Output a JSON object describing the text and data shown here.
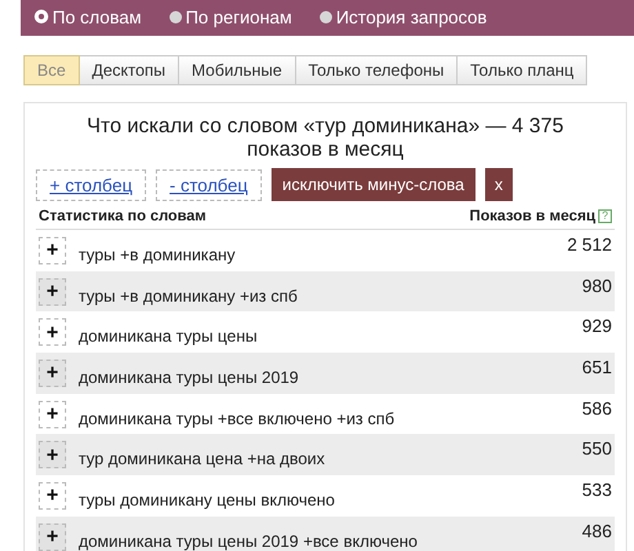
{
  "modes": [
    {
      "label": "По словам",
      "selected": true
    },
    {
      "label": "По регионам",
      "selected": false
    },
    {
      "label": "История запросов",
      "selected": false
    }
  ],
  "tabs": [
    {
      "label": "Все",
      "selected": true
    },
    {
      "label": "Десктопы",
      "selected": false
    },
    {
      "label": "Мобильные",
      "selected": false
    },
    {
      "label": "Только телефоны",
      "selected": false
    },
    {
      "label": "Только планц",
      "selected": false
    }
  ],
  "title": "Что искали со словом «тур доминикана» — 4 375 показов в месяц",
  "actions": {
    "add_column": "+ столбец",
    "remove_column": "- столбец",
    "exclude": "исключить минус-слова",
    "close": "x"
  },
  "table": {
    "columns": [
      "Статистика по словам",
      "Показов в месяц"
    ],
    "help": "?",
    "rows": [
      {
        "add": "+",
        "phrase": "туры +в доминикану",
        "count": "2 512"
      },
      {
        "add": "+",
        "phrase": "туры +в доминикану +из спб",
        "count": "980"
      },
      {
        "add": "+",
        "phrase": "доминикана туры цены",
        "count": "929"
      },
      {
        "add": "+",
        "phrase": "доминикана туры цены 2019",
        "count": "651"
      },
      {
        "add": "+",
        "phrase": "доминикана туры +все включено +из спб",
        "count": "586"
      },
      {
        "add": "+",
        "phrase": "тур доминикана цена +на двоих",
        "count": "550"
      },
      {
        "add": "+",
        "phrase": "туры доминикану цены включено",
        "count": "533"
      },
      {
        "add": "+",
        "phrase": "доминикана туры цены 2019 +все включено",
        "count": "486"
      }
    ]
  }
}
